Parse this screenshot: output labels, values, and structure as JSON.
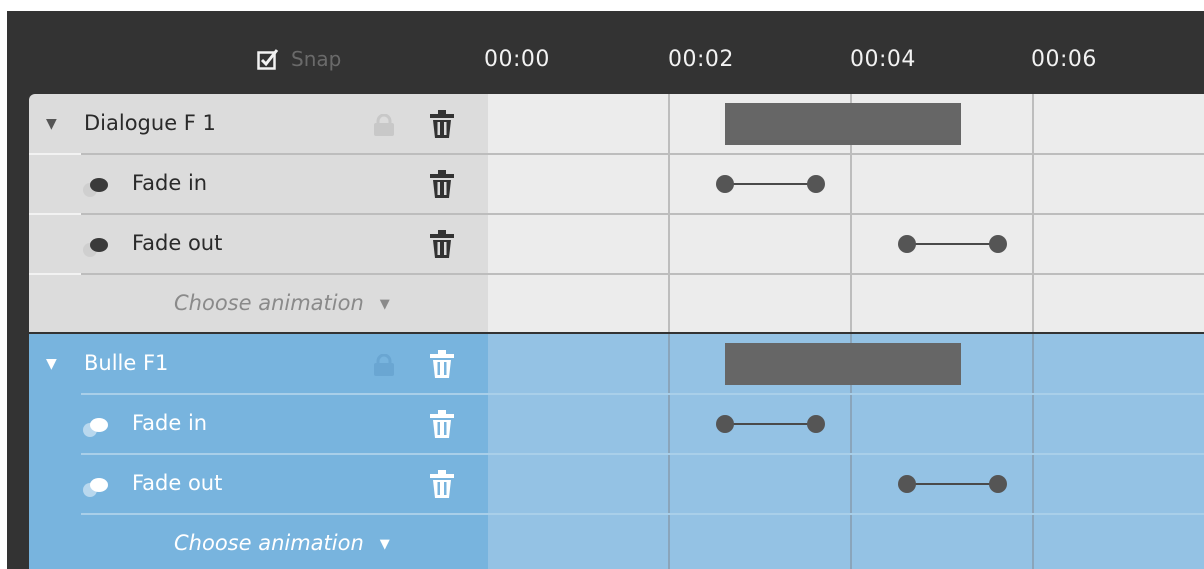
{
  "toolbar": {
    "snap_label": "Snap",
    "snap_checked": true
  },
  "timeline": {
    "ticks": [
      "00:00",
      "00:02",
      "00:04",
      "00:06"
    ]
  },
  "groups": [
    {
      "title": "Dialogue F 1",
      "color": "#dcdcdc",
      "locked": false,
      "block": {
        "start": 2.6,
        "end": 5.2
      },
      "animations": [
        {
          "label": "Fade in",
          "icon": "fade-icon",
          "start": 2.6,
          "end": 3.6
        },
        {
          "label": "Fade out",
          "icon": "fade-icon",
          "start": 4.6,
          "end": 5.6
        }
      ],
      "choose_label": "Choose animation"
    },
    {
      "title": "Bulle F1",
      "color": "#78b4de",
      "locked": false,
      "block": {
        "start": 2.6,
        "end": 5.2
      },
      "animations": [
        {
          "label": "Fade in",
          "icon": "fade-icon",
          "start": 2.6,
          "end": 3.6
        },
        {
          "label": "Fade out",
          "icon": "fade-icon",
          "start": 4.6,
          "end": 5.6
        }
      ],
      "choose_label": "Choose animation"
    }
  ]
}
